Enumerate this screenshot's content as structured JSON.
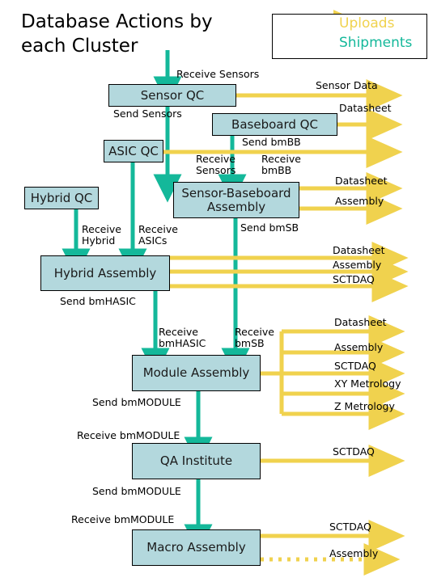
{
  "title": "Database Actions by\neach Cluster",
  "colors": {
    "upload_arrow": "#f0d24e",
    "shipment_arrow": "#14b89a",
    "node_fill": "#b3d8dd",
    "node_border": "#000000",
    "background": "#ffffff"
  },
  "legend": {
    "items": [
      {
        "label": "Uploads",
        "color": "#f0d24e",
        "style": "solid"
      },
      {
        "label": "Shipments",
        "color": "#14b89a",
        "style": "solid"
      }
    ]
  },
  "nodes": [
    {
      "id": "sensor-qc",
      "label": "Sensor QC"
    },
    {
      "id": "baseboard-qc",
      "label": "Baseboard QC"
    },
    {
      "id": "asic-qc",
      "label": "ASIC QC"
    },
    {
      "id": "hybrid-qc",
      "label": "Hybrid QC"
    },
    {
      "id": "sensor-baseboard-assembly",
      "label": "Sensor-Baseboard\nAssembly"
    },
    {
      "id": "hybrid-assembly",
      "label": "Hybrid Assembly"
    },
    {
      "id": "module-assembly",
      "label": "Module Assembly"
    },
    {
      "id": "qa-institute",
      "label": "QA Institute"
    },
    {
      "id": "macro-assembly",
      "label": "Macro Assembly"
    }
  ],
  "shipment_labels": [
    {
      "id": "receive-sensors-top",
      "text": "Receive Sensors"
    },
    {
      "id": "send-sensors",
      "text": "Send Sensors"
    },
    {
      "id": "send-bmbb",
      "text": "Send bmBB"
    },
    {
      "id": "receive-sensors-sb",
      "text": "Receive\nSensors"
    },
    {
      "id": "receive-bmbb",
      "text": "Receive\nbmBB"
    },
    {
      "id": "send-bmsb",
      "text": "Send bmSB"
    },
    {
      "id": "receive-hybrid",
      "text": "Receive\nHybrid"
    },
    {
      "id": "receive-asics",
      "text": "Receive\nASICs"
    },
    {
      "id": "send-bmhasic",
      "text": "Send bmHASIC"
    },
    {
      "id": "receive-bmhasic",
      "text": "Receive\nbmHASIC"
    },
    {
      "id": "receive-bmsb",
      "text": "Receive\nbmSB"
    },
    {
      "id": "send-bmmodule-1",
      "text": "Send bmMODULE"
    },
    {
      "id": "receive-bmmodule-1",
      "text": "Receive bmMODULE"
    },
    {
      "id": "send-bmmodule-2",
      "text": "Send bmMODULE"
    },
    {
      "id": "receive-bmmodule-2",
      "text": "Receive bmMODULE"
    }
  ],
  "upload_labels": [
    {
      "id": "up-sensor-data",
      "text": "Sensor Data"
    },
    {
      "id": "up-datasheet-bb",
      "text": "Datasheet"
    },
    {
      "id": "up-datasheet-sb",
      "text": "Datasheet"
    },
    {
      "id": "up-assembly-sb",
      "text": "Assembly"
    },
    {
      "id": "up-datasheet-ha",
      "text": "Datasheet"
    },
    {
      "id": "up-assembly-ha",
      "text": "Assembly"
    },
    {
      "id": "up-sctdaq-ha",
      "text": "SCTDAQ"
    },
    {
      "id": "up-datasheet-ma",
      "text": "Datasheet"
    },
    {
      "id": "up-assembly-ma",
      "text": "Assembly"
    },
    {
      "id": "up-sctdaq-ma",
      "text": "SCTDAQ"
    },
    {
      "id": "up-xy-metrology",
      "text": "XY Metrology"
    },
    {
      "id": "up-z-metrology",
      "text": "Z Metrology"
    },
    {
      "id": "up-sctdaq-qa",
      "text": "SCTDAQ"
    },
    {
      "id": "up-sctdaq-macro",
      "text": "SCTDAQ"
    },
    {
      "id": "up-assembly-macro",
      "text": "Assembly"
    }
  ],
  "chart_data": {
    "type": "diagram",
    "title": "Database Actions by each Cluster",
    "edge_types": [
      "Uploads",
      "Shipments"
    ]
  }
}
